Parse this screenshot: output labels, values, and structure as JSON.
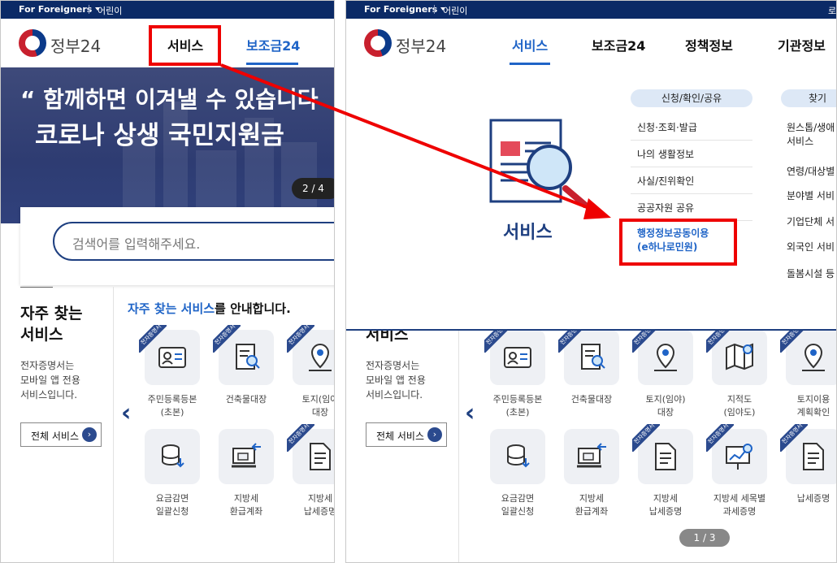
{
  "topbar": {
    "foreigners": "For Foreigners",
    "kids": "어린이",
    "login": "로"
  },
  "logo_text": "정부24",
  "nav": {
    "service": "서비스",
    "subsidy": "보조금24",
    "policy": "정책정보",
    "agency": "기관정보"
  },
  "hero": {
    "line1": "“ 함께하면 이겨낼 수 있습니다",
    "line2": "코로나 상생 국민지원금",
    "pager": "2 / 4"
  },
  "search": {
    "placeholder": "검색어를 입력해주세요."
  },
  "side": {
    "title": "자주 찾는 서비스",
    "title_line1": "자주 찾는",
    "title_line2": "서비스",
    "desc": "전자증명서는\n모바일 앱 전용\n서비스입니다.",
    "all_button": "전체 서비스",
    "arrow": "›"
  },
  "intro": {
    "highlight": "자주 찾는 서비스",
    "rest": "를 안내합니다."
  },
  "ribbon": "전자증명서",
  "tiles_left": [
    {
      "label": "주민등록등본\n(초본)",
      "icon": "id-card-icon",
      "ribbon": true
    },
    {
      "label": "건축물대장",
      "icon": "document-search-icon",
      "ribbon": true
    },
    {
      "label": "토지(임야\n대장",
      "icon": "map-pin-icon",
      "ribbon": true
    },
    {
      "label": "요금감면\n일괄신청",
      "icon": "coins-icon",
      "ribbon": false
    },
    {
      "label": "지방세\n환급계좌",
      "icon": "laptop-transfer-icon",
      "ribbon": false
    },
    {
      "label": "지방세\n납세증명",
      "icon": "document-icon",
      "ribbon": true
    }
  ],
  "dropdown": {
    "title": "서비스",
    "col1_header": "신청/확인/공유",
    "col1_items": [
      "신청·조회·발급",
      "나의 생활정보",
      "사실/진위확인",
      "공공자원 공유"
    ],
    "col1_highlight": "행정정보공동이용\n(e하나로민원)",
    "col2_header": "찾기",
    "col2_items": [
      "원스톱/생애\n서비스",
      "연령/대상별",
      "분야별 서비",
      "기업단체 서",
      "외국인 서비",
      "돌봄시설 등"
    ]
  },
  "tiles_right": [
    {
      "label": "주민등록등본\n(초본)",
      "icon": "id-card-icon",
      "ribbon": true
    },
    {
      "label": "건축물대장",
      "icon": "document-search-icon",
      "ribbon": true
    },
    {
      "label": "토지(임야)\n대장",
      "icon": "map-pin-icon",
      "ribbon": true
    },
    {
      "label": "지적도\n(임야도)",
      "icon": "map-icon",
      "ribbon": true
    },
    {
      "label": "토지이용\n계획확인",
      "icon": "map-pin-icon",
      "ribbon": true
    },
    {
      "label": "요금감면\n일괄신청",
      "icon": "coins-icon",
      "ribbon": false
    },
    {
      "label": "지방세\n환급계좌",
      "icon": "laptop-transfer-icon",
      "ribbon": false
    },
    {
      "label": "지방세\n납세증명",
      "icon": "document-icon",
      "ribbon": true
    },
    {
      "label": "지방세 세목별\n과세증명",
      "icon": "chart-board-icon",
      "ribbon": true
    },
    {
      "label": "납세증명",
      "icon": "document-icon",
      "ribbon": true
    }
  ],
  "pagination": "1 / 3",
  "colors": {
    "navy": "#0b2a66",
    "accent": "#1f64c7",
    "annotation": "#e00000"
  }
}
